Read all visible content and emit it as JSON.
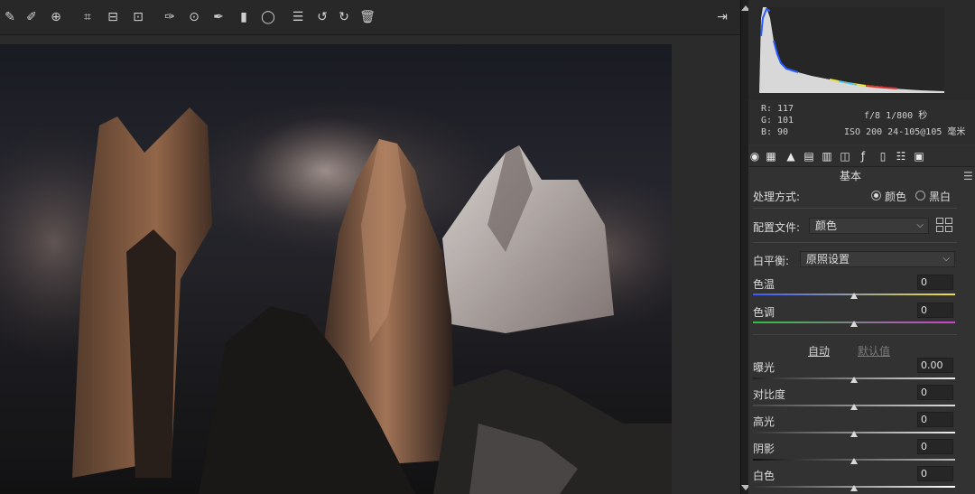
{
  "toolbar": {
    "tools": [
      {
        "name": "white-balance-tool",
        "glyph": "✎"
      },
      {
        "name": "color-sampler-tool",
        "glyph": "✐"
      },
      {
        "name": "targeted-adjust-tool",
        "glyph": "⊕"
      },
      {
        "name": "crop-tool",
        "glyph": "⌗"
      },
      {
        "name": "straighten-tool",
        "glyph": "⊟"
      },
      {
        "name": "transform-tool",
        "glyph": "⊡"
      },
      {
        "name": "spot-removal-tool",
        "glyph": "✑"
      },
      {
        "name": "red-eye-tool",
        "glyph": "⊙"
      },
      {
        "name": "adjustment-brush-tool",
        "glyph": "✒"
      },
      {
        "name": "graduated-filter-tool",
        "glyph": "▮"
      },
      {
        "name": "radial-filter-tool",
        "glyph": "◯"
      },
      {
        "name": "preferences-tool",
        "glyph": "☰"
      },
      {
        "name": "rotate-left-tool",
        "glyph": "↺"
      },
      {
        "name": "rotate-right-tool",
        "glyph": "↻"
      },
      {
        "name": "delete-tool",
        "glyph": "🗑"
      }
    ],
    "export_glyph": "⇥"
  },
  "info": {
    "r_label": "R:",
    "r": "117",
    "g_label": "G:",
    "g": "101",
    "b_label": "B:",
    "b": "90",
    "exif_line1": "f/8  1/800 秒",
    "exif_line2": "ISO 200  24-105@105 毫米"
  },
  "panel": {
    "title": "基本",
    "treatment_label": "处理方式:",
    "color_label": "颜色",
    "bw_label": "黑白",
    "profile_label": "配置文件:",
    "profile_value": "颜色",
    "wb_label": "白平衡:",
    "wb_value": "原照设置",
    "sliders_top": [
      {
        "label": "色温",
        "value": "0"
      },
      {
        "label": "色调",
        "value": "0"
      }
    ],
    "auto_label": "自动",
    "default_label": "默认值",
    "sliders": [
      {
        "label": "曝光",
        "value": "0.00"
      },
      {
        "label": "对比度",
        "value": "0"
      },
      {
        "label": "高光",
        "value": "0"
      },
      {
        "label": "阴影",
        "value": "0"
      },
      {
        "label": "白色",
        "value": "0"
      }
    ]
  },
  "colors": {
    "accent": "#e8e8e8",
    "panel": "#323232"
  }
}
